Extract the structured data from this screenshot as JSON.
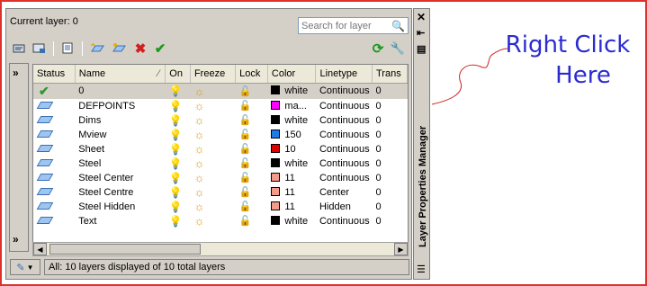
{
  "window": {
    "current_layer": "Current layer: 0",
    "vertical_title": "Layer Properties Manager"
  },
  "search": {
    "placeholder": "Search for layer",
    "icon": "magnifier-icon"
  },
  "toolbar": {
    "left_icons": [
      "new-property-filter-icon",
      "new-group-filter-icon",
      "layer-states-manager-icon",
      "new-layer-icon",
      "new-layer-vp-frozen-icon",
      "delete-layer-icon",
      "set-current-icon"
    ],
    "right_icons": [
      "refresh-icon",
      "settings-icon"
    ]
  },
  "grid": {
    "columns": [
      "Status",
      "Name",
      "On",
      "Freeze",
      "Lock",
      "Color",
      "Linetype",
      "Trans"
    ],
    "rows": [
      {
        "status": "current",
        "name": "0",
        "color_hex": "#000000",
        "color_name": "white",
        "linetype": "Continuous",
        "trans": "0",
        "selected": true
      },
      {
        "status": "layer",
        "name": "DEFPOINTS",
        "color_hex": "#ff00ff",
        "color_name": "ma...",
        "linetype": "Continuous",
        "trans": "0",
        "selected": false
      },
      {
        "status": "layer",
        "name": "Dims",
        "color_hex": "#000000",
        "color_name": "white",
        "linetype": "Continuous",
        "trans": "0",
        "selected": false
      },
      {
        "status": "layer",
        "name": "Mview",
        "color_hex": "#1e7ae6",
        "color_name": "150",
        "linetype": "Continuous",
        "trans": "0",
        "selected": false
      },
      {
        "status": "layer",
        "name": "Sheet",
        "color_hex": "#e00000",
        "color_name": "10",
        "linetype": "Continuous",
        "trans": "0",
        "selected": false
      },
      {
        "status": "layer",
        "name": "Steel",
        "color_hex": "#000000",
        "color_name": "white",
        "linetype": "Continuous",
        "trans": "0",
        "selected": false
      },
      {
        "status": "layer",
        "name": "Steel Center",
        "color_hex": "#f29b8b",
        "color_name": "11",
        "linetype": "Continuous",
        "trans": "0",
        "selected": false
      },
      {
        "status": "layer",
        "name": "Steel Centre",
        "color_hex": "#f29b8b",
        "color_name": "11",
        "linetype": "Center",
        "trans": "0",
        "selected": false
      },
      {
        "status": "layer",
        "name": "Steel Hidden",
        "color_hex": "#f29b8b",
        "color_name": "11",
        "linetype": "Hidden",
        "trans": "0",
        "selected": false
      },
      {
        "status": "layer",
        "name": "Text",
        "color_hex": "#000000",
        "color_name": "white",
        "linetype": "Continuous",
        "trans": "0",
        "selected": false
      }
    ]
  },
  "status_bar": {
    "text": "All: 10 layers displayed of 10 total layers"
  },
  "annotation": {
    "line1": "Right  Click",
    "line2": "Here",
    "color": "#2b2bd0"
  },
  "colors": {
    "frame_border": "#e0302a",
    "panel_bg": "#d4d0c8",
    "selected_row": "#d4d0c8"
  }
}
